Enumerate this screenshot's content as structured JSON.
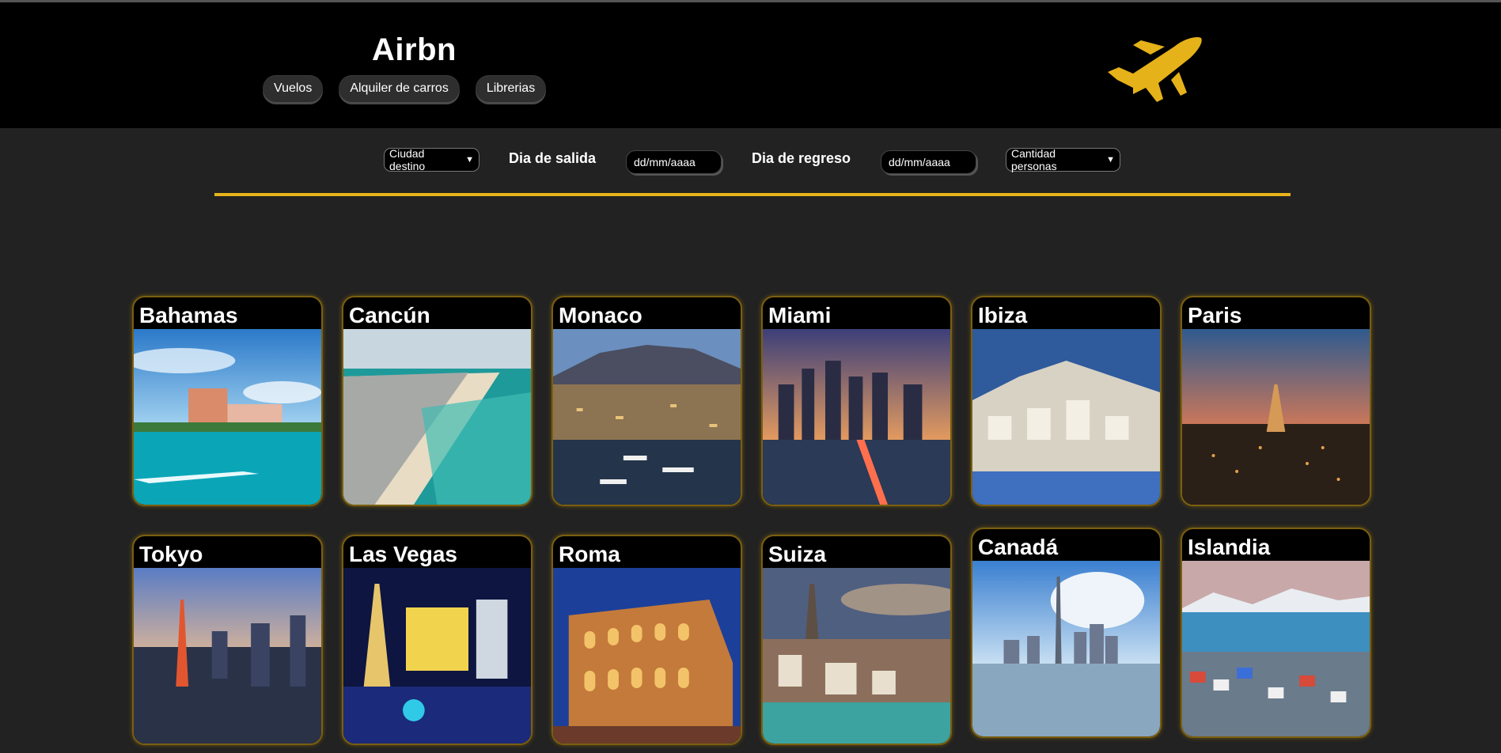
{
  "header": {
    "brand": "Airbn",
    "nav": [
      "Vuelos",
      "Alquiler de carros",
      "Librerias"
    ],
    "logo_icon": "airplane-icon",
    "logo_color": "#e6b21a"
  },
  "search": {
    "city_select": "Ciudad destino",
    "departure_label": "Dia de salida",
    "departure_placeholder": "dd/mm/aaaa",
    "return_label": "Dia de regreso",
    "return_placeholder": "dd/mm/aaaa",
    "people_select": "Cantidad personas"
  },
  "colors": {
    "background": "#222222",
    "header": "#000000",
    "accent": "#e6b21a"
  },
  "destinations": [
    {
      "name": "Bahamas"
    },
    {
      "name": "Cancún"
    },
    {
      "name": "Monaco"
    },
    {
      "name": "Miami"
    },
    {
      "name": "Ibiza"
    },
    {
      "name": "Paris"
    },
    {
      "name": "Tokyo"
    },
    {
      "name": "Las Vegas"
    },
    {
      "name": "Roma"
    },
    {
      "name": "Suiza"
    },
    {
      "name": "Canadá"
    },
    {
      "name": "Islandia"
    }
  ]
}
